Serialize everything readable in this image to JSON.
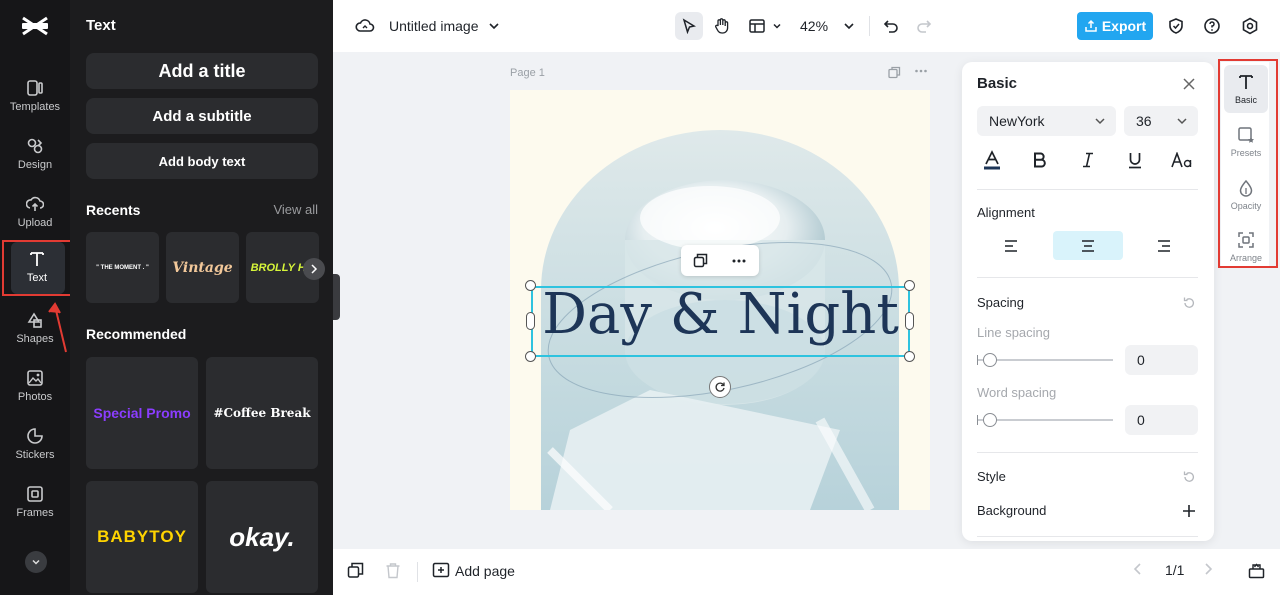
{
  "rail": {
    "items": [
      {
        "label": "Templates",
        "icon": "templates-icon"
      },
      {
        "label": "Design",
        "icon": "design-icon"
      },
      {
        "label": "Upload",
        "icon": "upload-icon"
      },
      {
        "label": "Text",
        "icon": "text-icon",
        "active": true
      },
      {
        "label": "Shapes",
        "icon": "shapes-icon"
      },
      {
        "label": "Photos",
        "icon": "photos-icon"
      },
      {
        "label": "Stickers",
        "icon": "stickers-icon"
      },
      {
        "label": "Frames",
        "icon": "frames-icon"
      }
    ]
  },
  "panel": {
    "title": "Text",
    "add_title": "Add a title",
    "add_subtitle": "Add a subtitle",
    "add_body": "Add body text",
    "recents_title": "Recents",
    "view_all": "View all",
    "recents": [
      "\" THE MOMENT . \"",
      "Vintage",
      "BROLLY HO"
    ],
    "recommended_title": "Recommended",
    "recommended": [
      "Special Promo",
      "#Coffee Break",
      "BABYTOY",
      "okay."
    ]
  },
  "topbar": {
    "title": "Untitled image",
    "zoom": "42%",
    "export_label": "Export"
  },
  "canvas": {
    "page_label": "Page 1",
    "text": "Day & Night"
  },
  "props": {
    "title": "Basic",
    "font": "NewYork",
    "size": "36",
    "alignment_label": "Alignment",
    "spacing_label": "Spacing",
    "line_spacing_label": "Line spacing",
    "line_spacing_value": "0",
    "word_spacing_label": "Word spacing",
    "word_spacing_value": "0",
    "style_label": "Style",
    "background_label": "Background"
  },
  "strip": {
    "items": [
      {
        "label": "Basic",
        "icon": "text-icon",
        "active": true
      },
      {
        "label": "Presets",
        "icon": "presets-icon"
      },
      {
        "label": "Opacity",
        "icon": "opacity-icon"
      },
      {
        "label": "Arrange",
        "icon": "arrange-icon"
      }
    ]
  },
  "bottombar": {
    "add_page": "Add page",
    "page_count": "1/1"
  },
  "colors": {
    "accent": "#22a6f0",
    "selection": "#2ec3df",
    "highlight": "#e23b33",
    "text_color": "#1d3557"
  }
}
